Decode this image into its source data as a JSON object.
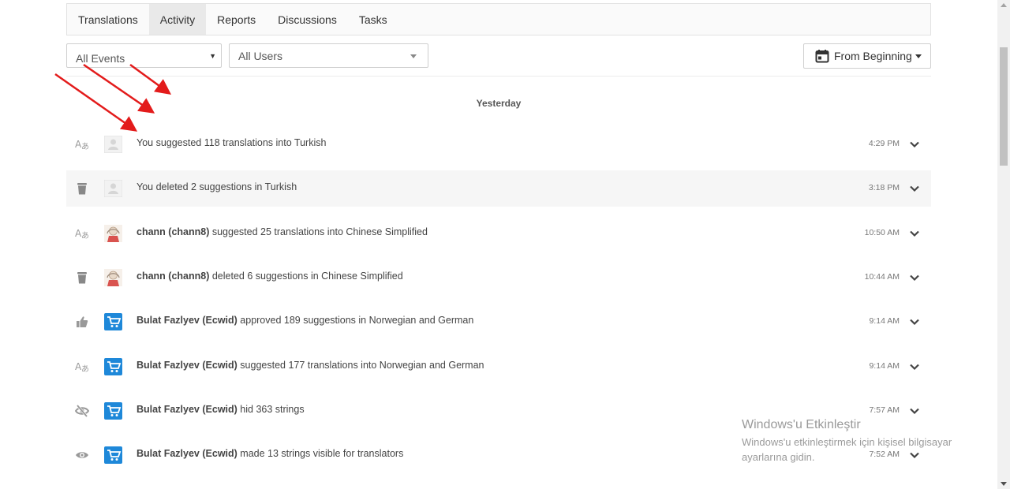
{
  "tabs": [
    {
      "label": "Translations",
      "active": false
    },
    {
      "label": "Activity",
      "active": true
    },
    {
      "label": "Reports",
      "active": false
    },
    {
      "label": "Discussions",
      "active": false
    },
    {
      "label": "Tasks",
      "active": false
    }
  ],
  "filters": {
    "events": "All Events",
    "users": "All Users",
    "date_range": "From Beginning"
  },
  "day_label": "Yesterday",
  "events": [
    {
      "icon": "translate-icon",
      "avatar": "default-avatar",
      "actor": "",
      "text": "You suggested 118 translations into Turkish",
      "time": "4:29 PM"
    },
    {
      "icon": "trash-icon",
      "avatar": "default-avatar",
      "actor": "",
      "text": "You deleted 2 suggestions in Turkish",
      "time": "3:18 PM"
    },
    {
      "icon": "translate-icon",
      "avatar": "user-avatar",
      "actor": "chann (chann8)",
      "text": " suggested 25 translations into Chinese Simplified",
      "time": "10:50 AM"
    },
    {
      "icon": "trash-icon",
      "avatar": "user-avatar",
      "actor": "chann (chann8)",
      "text": " deleted 6 suggestions in Chinese Simplified",
      "time": "10:44 AM"
    },
    {
      "icon": "thumbs-up-icon",
      "avatar": "cart-avatar",
      "actor": "Bulat Fazlyev (Ecwid)",
      "text": " approved 189 suggestions in Norwegian and German",
      "time": "9:14 AM"
    },
    {
      "icon": "translate-icon",
      "avatar": "cart-avatar",
      "actor": "Bulat Fazlyev (Ecwid)",
      "text": " suggested 177 translations into Norwegian and German",
      "time": "9:14 AM"
    },
    {
      "icon": "eye-off-icon",
      "avatar": "cart-avatar",
      "actor": "Bulat Fazlyev (Ecwid)",
      "text": " hid 363 strings",
      "time": "7:57 AM"
    },
    {
      "icon": "eye-icon",
      "avatar": "cart-avatar",
      "actor": "Bulat Fazlyev (Ecwid)",
      "text": " made 13 strings visible for translators",
      "time": "7:52 AM"
    }
  ],
  "watermark": {
    "title": "Windows'u Etkinleştir",
    "line1": "Windows'u etkinleştirmek için kişisel bilgisayar",
    "line2": "ayarlarına gidin."
  },
  "colors": {
    "arrow": "#e31b1b",
    "cart_avatar": "#1e88d9",
    "active_tab": "#e9e9e9",
    "shaded_row": "#f6f6f6"
  }
}
